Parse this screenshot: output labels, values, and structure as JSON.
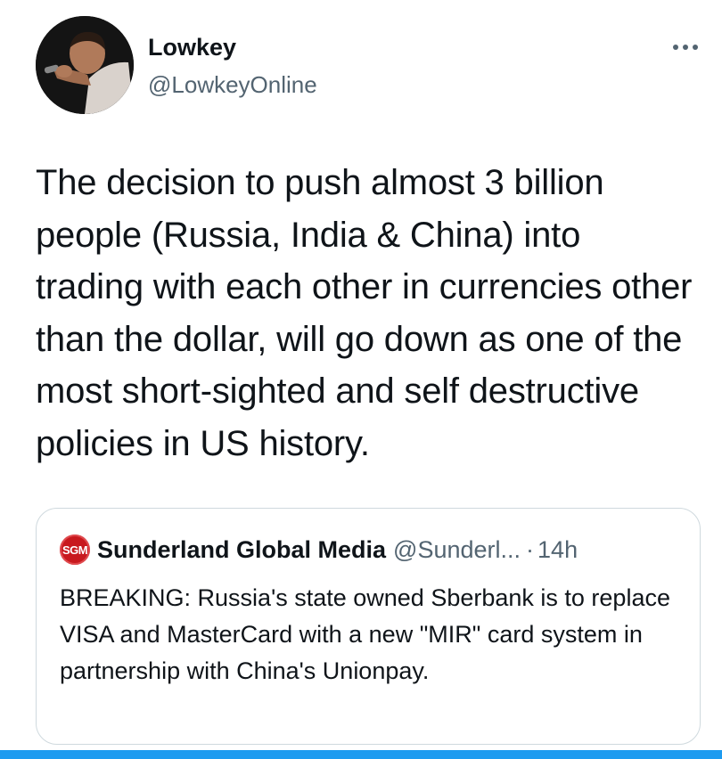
{
  "author": {
    "display_name": "Lowkey",
    "handle": "@LowkeyOnline",
    "avatar_icon": "profile-photo"
  },
  "menu": {
    "icon": "more-horizontal-icon"
  },
  "tweet": {
    "text": "The decision to push almost 3 billion people (Russia, India & China) into trading with each other in currencies other than the dollar, will go down as one of the most short-sighted and self destructive policies in US history."
  },
  "quoted_tweet": {
    "logo_text": "SGM",
    "display_name": "Sunderland Global Media",
    "handle": "@Sunderl...",
    "separator": "·",
    "time": "14h",
    "text": "BREAKING: Russia's state owned Sberbank is to replace VISA and MasterCard with a new \"MIR\" card system in partnership with China's Unionpay."
  },
  "colors": {
    "text_primary": "#0f1419",
    "text_secondary": "#536471",
    "border": "#cfd9de",
    "accent": "#1d9bf0",
    "sgm_red": "#c8191e"
  }
}
